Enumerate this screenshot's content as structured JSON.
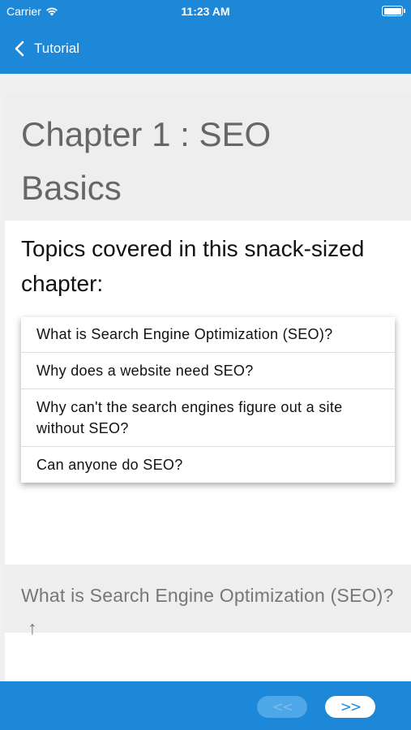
{
  "status_bar": {
    "carrier": "Carrier",
    "time": "11:23 AM"
  },
  "nav": {
    "back_label": "Tutorial"
  },
  "chapter": {
    "title_line1": "Chapter 1 : SEO",
    "title_line2": "Basics",
    "intro": "Topics covered in this snack-sized chapter:"
  },
  "topics": [
    "What is Search Engine Optimization (SEO)?",
    "Why does a website need SEO?",
    "Why can't the search engines figure out a site without SEO?",
    "Can anyone do SEO?"
  ],
  "section": {
    "heading": "What is Search Engine Optimization (SEO)?",
    "up_arrow": "↑"
  },
  "pager": {
    "prev_label": "<<",
    "next_label": ">>"
  },
  "colors": {
    "primary": "#1e88d8",
    "header_band": "#eeeeee",
    "title_text": "#666666"
  }
}
